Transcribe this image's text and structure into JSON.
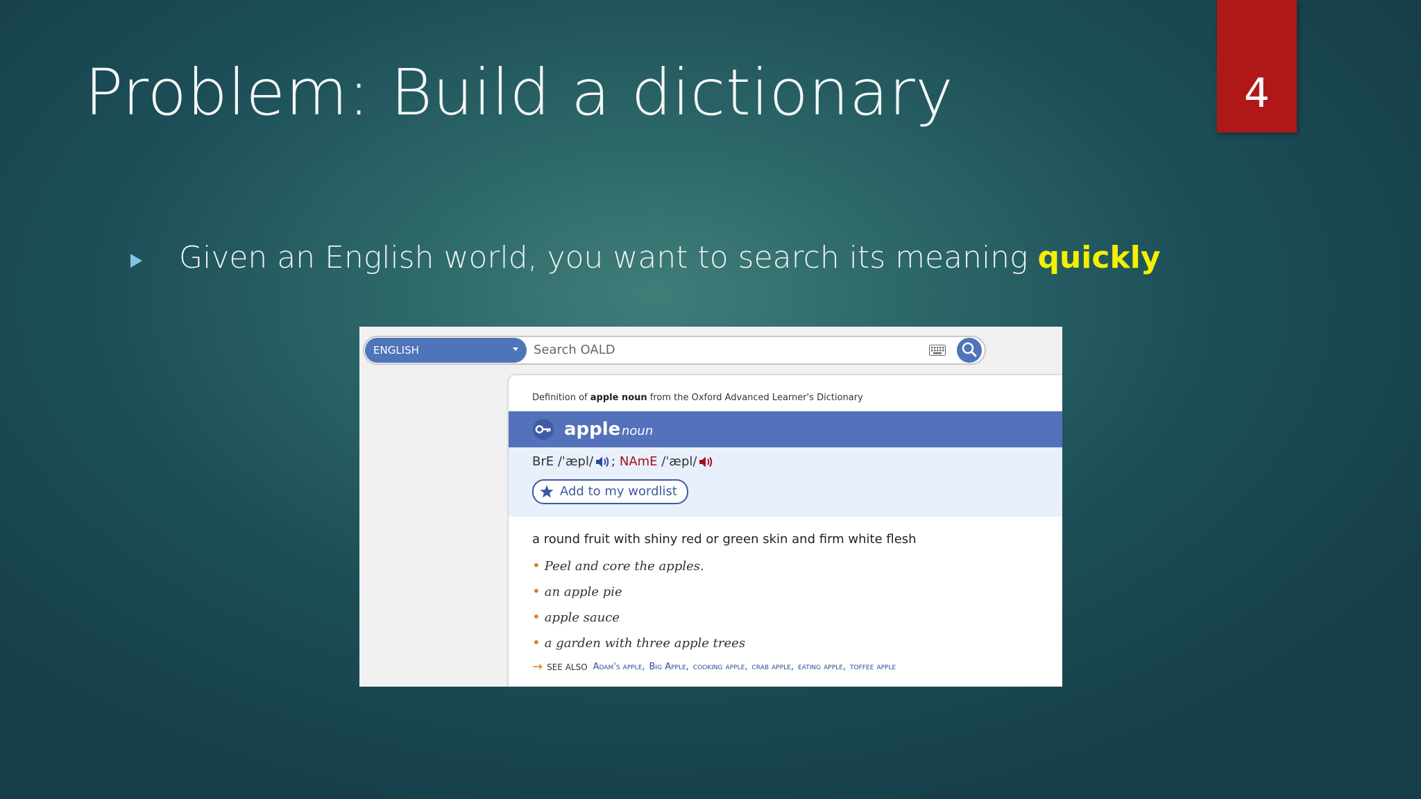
{
  "slide": {
    "title": "Problem: Build a dictionary",
    "number": "4",
    "bullet_text": "Given an English world, you want to search its meaning ",
    "bullet_emphasis": "quickly",
    "colors": {
      "accent_red": "#b01818",
      "emphasis_yellow": "#f3f000",
      "bullet_blue": "#7fc4e3"
    }
  },
  "oald": {
    "language_select": "ENGLISH",
    "search_placeholder": "Search OALD",
    "keyboard_icon": "keyboard-icon",
    "search_icon": "search-icon",
    "source": {
      "prefix": "Definition of ",
      "word": "apple noun",
      "suffix": " from the Oxford Advanced Learner's Dictionary"
    },
    "headword": "apple",
    "part_of_speech": "noun",
    "pronunciation": {
      "bre_label": "BrE",
      "bre_ipa": "/ˈæpl/",
      "separator": ";",
      "name_label": "NAmE",
      "name_ipa": "/ˈæpl/"
    },
    "wordlist_button": "Add to my wordlist",
    "definition": "a round fruit with shiny red or green skin and firm white flesh",
    "examples": [
      "Peel and core the apples.",
      "an apple pie",
      "apple sauce",
      "a garden with three apple trees"
    ],
    "see_also_label": "SEE ALSO",
    "see_also": [
      "Adam's apple",
      "Big Apple",
      "cooking apple",
      "crab apple",
      "eating apple",
      "toffee apple"
    ],
    "colors": {
      "header_blue": "#5472bb",
      "pron_bg": "#e8f0fb",
      "name_red": "#a50d1e",
      "bullet_orange": "#e07d1a",
      "link_blue": "#2a4b9b"
    }
  }
}
